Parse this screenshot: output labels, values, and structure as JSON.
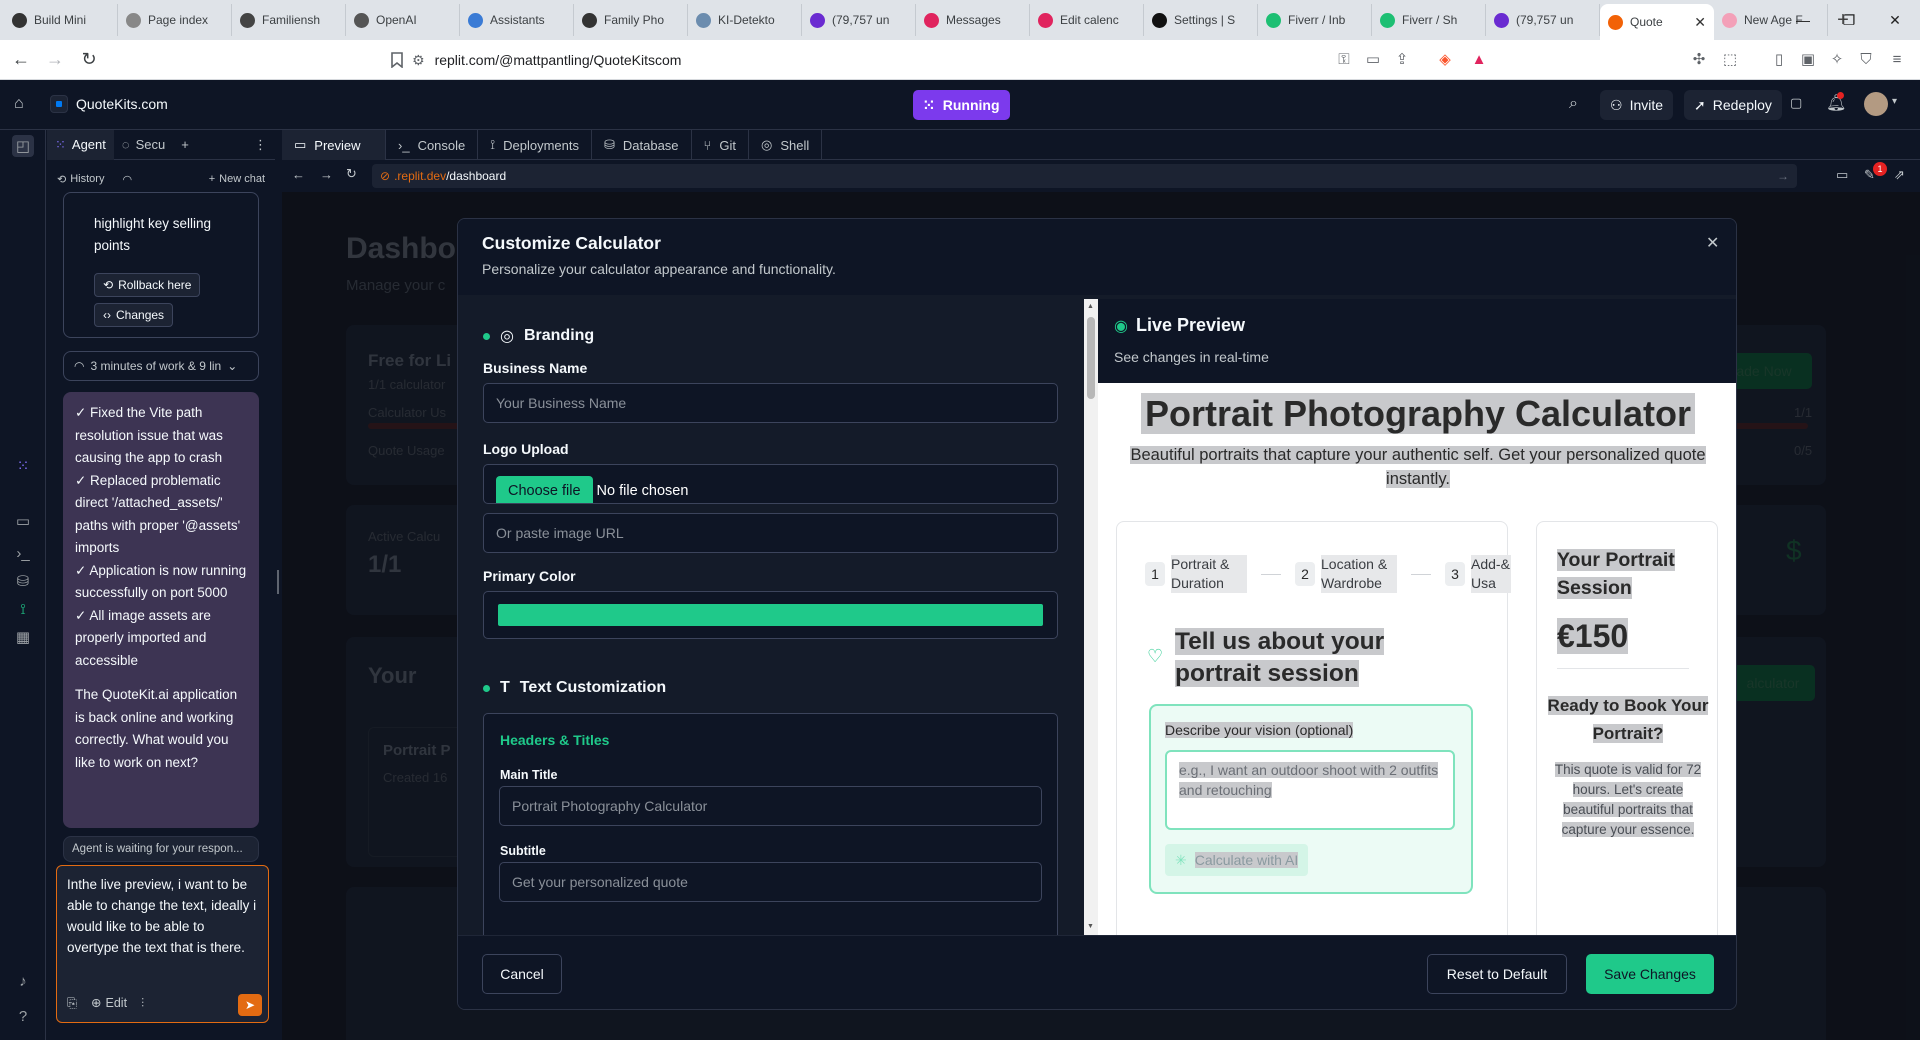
{
  "browser": {
    "tabs": [
      {
        "label": "Build Mini",
        "color": "#333333"
      },
      {
        "label": "Page index",
        "color": "#888888"
      },
      {
        "label": "Familiensh",
        "color": "#444444"
      },
      {
        "label": "OpenAI",
        "color": "#555555"
      },
      {
        "label": "Assistants",
        "color": "#3a7bd5"
      },
      {
        "label": "Family Pho",
        "color": "#333333"
      },
      {
        "label": "KI-Detekto",
        "color": "#6b8cae"
      },
      {
        "label": "(79,757 un",
        "color": "#6a2bd1"
      },
      {
        "label": "Messages",
        "color": "#e0245e"
      },
      {
        "label": "Edit calenc",
        "color": "#e0245e"
      },
      {
        "label": "Settings | S",
        "color": "#111111"
      },
      {
        "label": "Fiverr / Inb",
        "color": "#1dbf73"
      },
      {
        "label": "Fiverr / Sh",
        "color": "#1dbf73"
      },
      {
        "label": "(79,757 un",
        "color": "#6a2bd1"
      },
      {
        "label": "Quote",
        "color": "#f26207",
        "active": true
      },
      {
        "label": "New Age F",
        "color": "#f3a0b8"
      }
    ],
    "url": "replit.com/@mattpantling/QuoteKitscom"
  },
  "header": {
    "project_name": "QuoteKits.com",
    "run_status": "Running",
    "invite_label": "Invite",
    "redeploy_label": "Redeploy"
  },
  "agent": {
    "tab_agent": "Agent",
    "tab_security": "Secu",
    "history_label": "History",
    "new_chat_label": "New chat",
    "prev_text_fragment": "highlight key selling points",
    "rollback_label": "Rollback here",
    "changes_label": "Changes",
    "work_summary": "3 minutes of work & 9 lin",
    "message_lines": [
      "✓ Fixed the Vite path resolution issue that was causing the app to crash",
      "✓ Replaced problematic direct '/attached_assets/' paths with proper '@assets' imports",
      "✓ Application is now running successfully on port 5000",
      "✓ All image assets are properly imported and accessible"
    ],
    "message_closing": "The QuoteKit.ai application is back online and working correctly. What would you like to work on next?",
    "waiting_status": "Agent is waiting for your respon...",
    "input_text": "Inthe live preview, i want to be able to change the text, ideally i would like to be able to overtype the text that is there.",
    "edit_label": "Edit"
  },
  "workspace": {
    "tabs": [
      "Preview",
      "Console",
      "Deployments",
      "Database",
      "Git",
      "Shell"
    ],
    "preview_url_prefix": ".replit.dev",
    "preview_url_path": "/dashboard",
    "notification_count": "1"
  },
  "dashboard_bg": {
    "title": "Dashbo",
    "subtitle": "Manage your c",
    "free_label": "Free for Li",
    "calc_count": "1/1 calculator",
    "calc_usage": "Calculator Us",
    "quote_usage": "Quote Usage",
    "usage_1": "1/1",
    "usage_2": "0/5",
    "upgrade": "ade Now",
    "active_label": "Active Calcu",
    "active_value": "1/1",
    "your_label": "Your",
    "portrait_label": "Portrait P",
    "created_label": "Created 16",
    "calculator_btn": "alculator"
  },
  "modal": {
    "title": "Customize Calculator",
    "subtitle": "Personalize your calculator appearance and functionality.",
    "branding_heading": "Branding",
    "business_name_label": "Business Name",
    "business_name_placeholder": "Your Business Name",
    "logo_label": "Logo Upload",
    "choose_file": "Choose file",
    "no_file": "No file chosen",
    "image_url_placeholder": "Or paste image URL",
    "primary_color_label": "Primary Color",
    "primary_color": "#1fc98a",
    "text_heading": "Text Customization",
    "headers_titles": "Headers & Titles",
    "main_title_label": "Main Title",
    "main_title_placeholder": "Portrait Photography Calculator",
    "subtitle_label": "Subtitle",
    "subtitle_placeholder": "Get your personalized quote",
    "cancel_label": "Cancel",
    "reset_label": "Reset to Default",
    "save_label": "Save Changes"
  },
  "preview": {
    "heading": "Live Preview",
    "subheading": "See changes in real-time",
    "calc_title": "Portrait Photography Calculator",
    "calc_subtitle": "Beautiful portraits that capture your authentic self. Get your personalized quote instantly.",
    "steps": [
      {
        "num": "1",
        "label": "Portrait & Duration"
      },
      {
        "num": "2",
        "label": "Location & Wardrobe"
      },
      {
        "num": "3",
        "label": "Add-& Usa"
      }
    ],
    "section_title": "Tell us about your portrait session",
    "vision_label": "Describe your vision (optional)",
    "vision_placeholder": "e.g., I want an outdoor shoot with 2 outfits and retouching",
    "ai_button": "Calculate with AI",
    "session_title": "Your Portrait Session",
    "price": "€150",
    "ready_title": "Ready to Book Your Portrait?",
    "valid_text": "This quote is valid for 72 hours. Let's create beautiful portraits that capture your essence."
  }
}
